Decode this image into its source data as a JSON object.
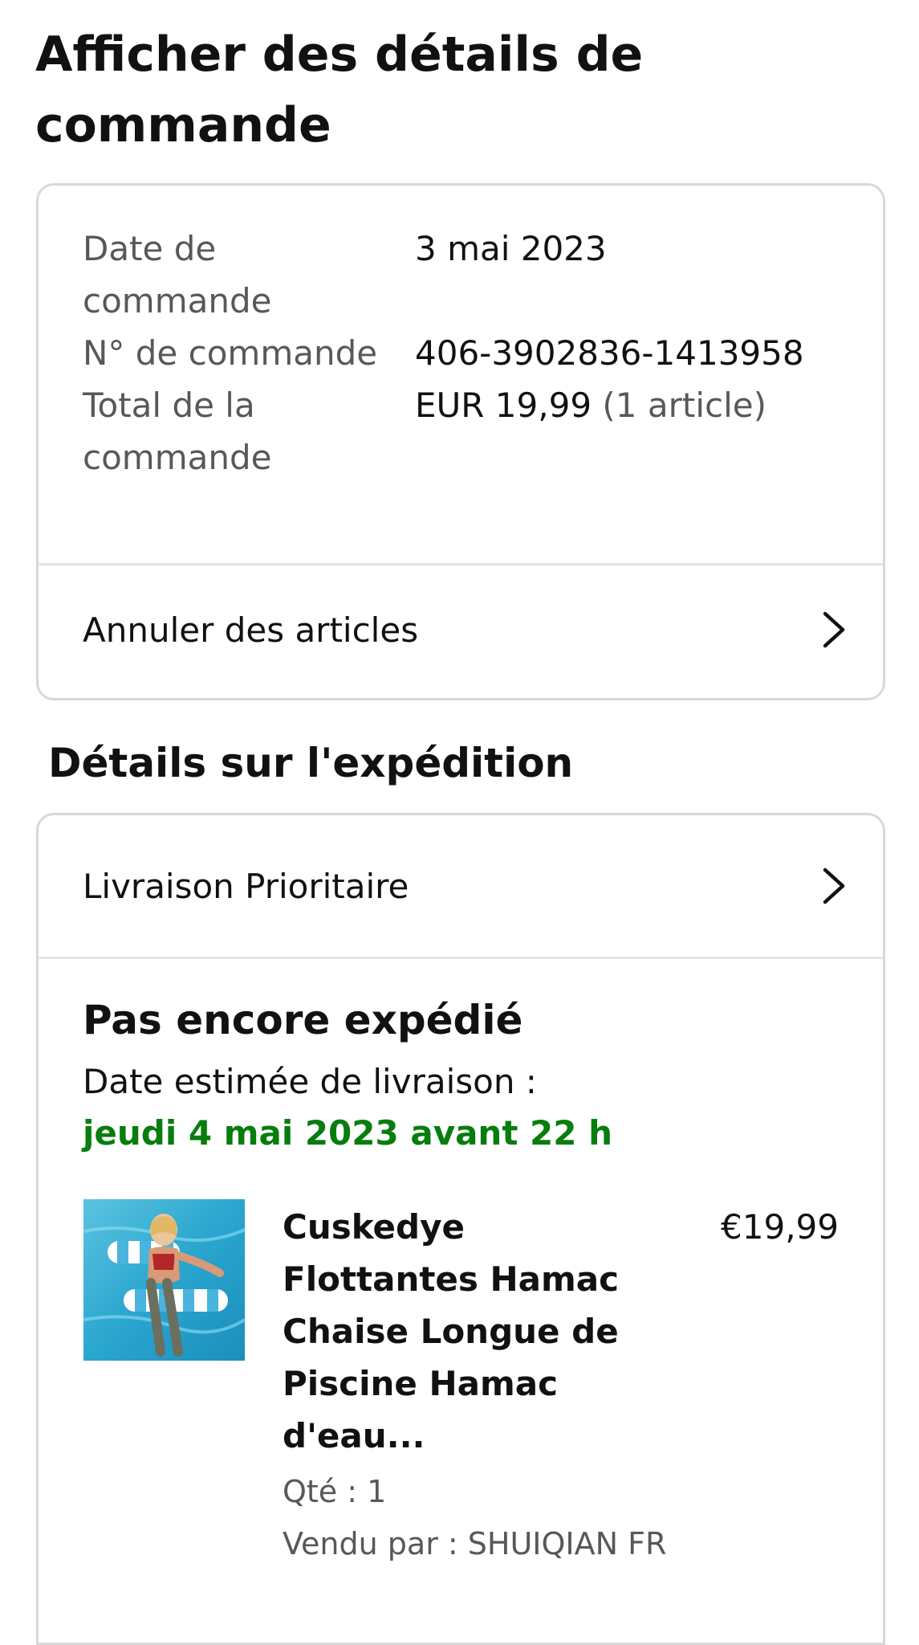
{
  "page": {
    "title": "Afficher des détails de commande"
  },
  "order_summary": {
    "rows": [
      {
        "label": "Date de commande",
        "value": "3 mai 2023"
      },
      {
        "label": "N° de commande",
        "value": "406-3902836-1413958"
      },
      {
        "label": "Total de la commande",
        "value": "EUR 19,99",
        "value_suffix": "(1 article)"
      }
    ],
    "cancel_link": "Annuler des articles"
  },
  "shipping": {
    "heading": "Détails sur l'expédition",
    "method_link": "Livraison Prioritaire",
    "status": "Pas encore expédié",
    "eta_label": "Date estimée de livraison :",
    "eta_value": "jeudi 4 mai 2023 avant 22 h",
    "eta_color": "#067d0d"
  },
  "product": {
    "title": "Cuskedye Flottantes Hamac Chaise Longue de Piscine Hamac d'eau...",
    "price": "€19,99",
    "quantity": "Qté : 1",
    "seller": "Vendu par : SHUIQIAN FR",
    "image_icon": "pool-hammock-photo"
  },
  "icons": {
    "chevron": "chevron-right-icon"
  }
}
